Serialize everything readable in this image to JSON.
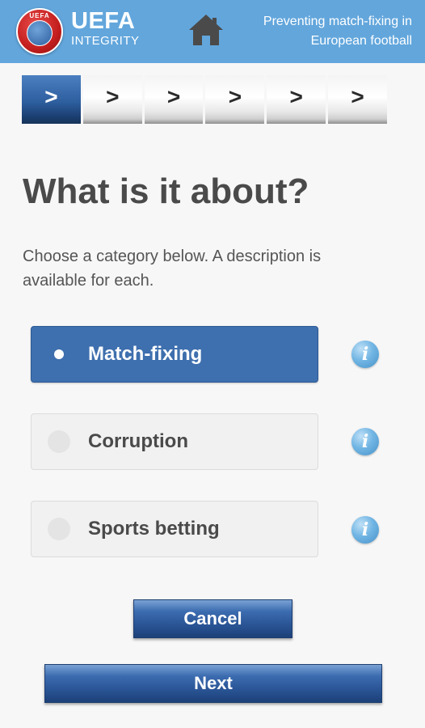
{
  "header": {
    "brand_name": "UEFA",
    "brand_sub": "INTEGRITY",
    "logo_text": "UEFA",
    "tagline": "Preventing match-fixing in European football",
    "home_icon": "home-icon",
    "colors": {
      "background": "#62a6dc",
      "logo": "#c41e1e"
    }
  },
  "steps": {
    "active_index": 0,
    "items": [
      {
        "label": ">",
        "state": "active"
      },
      {
        "label": ">",
        "state": "inactive"
      },
      {
        "label": ">",
        "state": "inactive"
      },
      {
        "label": ">",
        "state": "inactive"
      },
      {
        "label": ">",
        "state": "inactive"
      },
      {
        "label": ">",
        "state": "inactive"
      }
    ]
  },
  "main": {
    "title": "What is it about?",
    "intro": "Choose a category below. A description is available for each.",
    "options": [
      {
        "label": "Match-fixing",
        "selected": true,
        "info_icon": "info-icon"
      },
      {
        "label": "Corruption",
        "selected": false,
        "info_icon": "info-icon"
      },
      {
        "label": "Sports betting",
        "selected": false,
        "info_icon": "info-icon"
      }
    ],
    "info_glyph": "i"
  },
  "actions": {
    "cancel_label": "Cancel",
    "next_label": "Next",
    "colors": {
      "button": "#2a5596",
      "selected_option": "#3e6fae"
    }
  }
}
